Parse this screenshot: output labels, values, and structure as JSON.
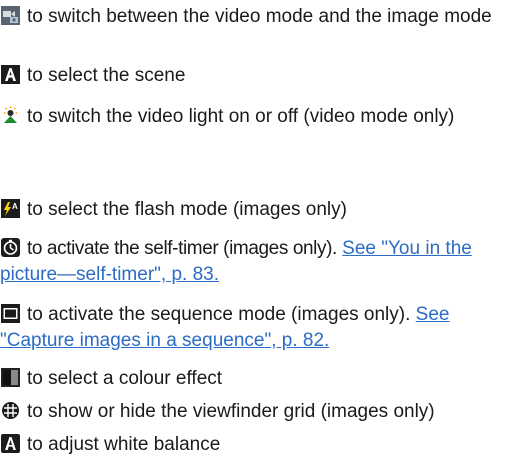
{
  "items": [
    {
      "icon": "video-image-mode-icon",
      "text": "to switch between the video mode and the image mode"
    },
    {
      "icon": "scene-icon",
      "text": "to select the scene"
    },
    {
      "icon": "video-light-icon",
      "text": "to switch the video light on or off (video mode only)"
    },
    {
      "icon": "flash-mode-icon",
      "text": "to select the flash mode (images only)"
    },
    {
      "icon": "self-timer-icon",
      "text": "to activate the self-timer (images only).",
      "link": "See \"You in the picture—self-timer\", p. 83."
    },
    {
      "icon": "sequence-mode-icon",
      "text": "to activate the sequence mode (images only).",
      "link": "See \"Capture images in a sequence\", p. 82."
    },
    {
      "icon": "colour-effect-icon",
      "text": "to select a colour effect"
    },
    {
      "icon": "viewfinder-grid-icon",
      "text": "to show or hide the viewfinder grid (images only)"
    },
    {
      "icon": "white-balance-icon",
      "text": "to adjust white balance"
    }
  ],
  "colors": {
    "link": "#2b6cc4",
    "icon_bg": "#1c1c1c"
  }
}
